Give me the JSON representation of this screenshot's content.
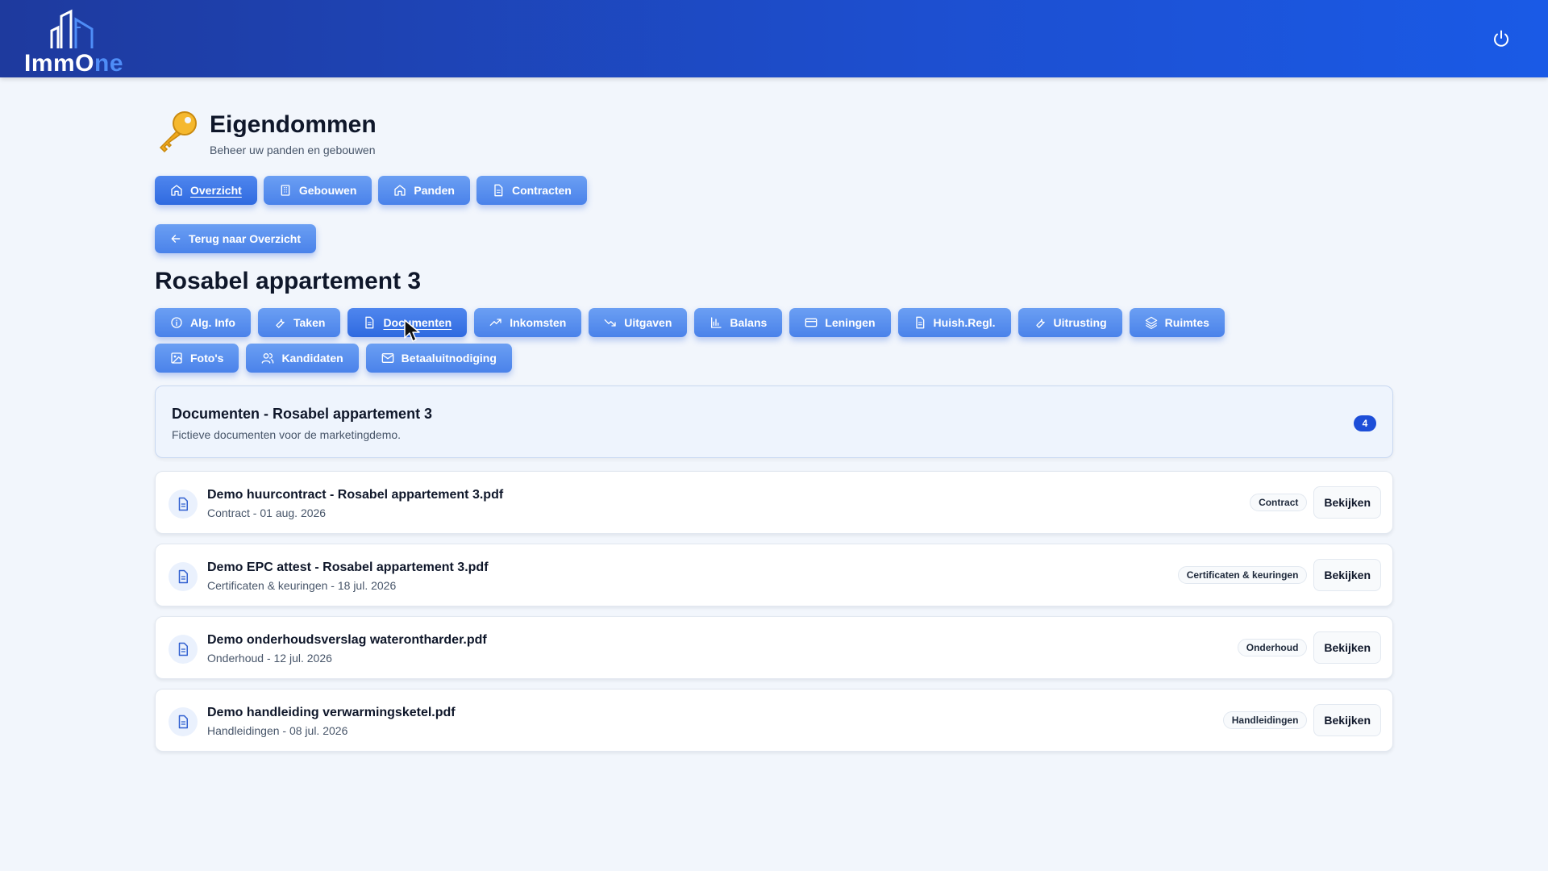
{
  "brand": {
    "logo_main": "ImmO",
    "logo_accent": "ne"
  },
  "header": {
    "power_icon": "power-icon"
  },
  "page": {
    "title": "Eigendommen",
    "subtitle": "Beheer uw panden en gebouwen",
    "icon": "key-icon"
  },
  "main_tabs": [
    {
      "label": "Overzicht",
      "icon": "home-icon",
      "active": true
    },
    {
      "label": "Gebouwen",
      "icon": "building-icon",
      "active": false
    },
    {
      "label": "Panden",
      "icon": "home-icon",
      "active": false
    },
    {
      "label": "Contracten",
      "icon": "document-icon",
      "active": false
    }
  ],
  "back_button": {
    "label": "Terug naar Overzicht",
    "icon": "arrow-left-icon"
  },
  "property": {
    "title": "Rosabel appartement 3"
  },
  "sub_tabs": [
    {
      "label": "Alg. Info",
      "icon": "info-icon",
      "active": false
    },
    {
      "label": "Taken",
      "icon": "wrench-icon",
      "active": false
    },
    {
      "label": "Documenten",
      "icon": "document-icon",
      "active": true
    },
    {
      "label": "Inkomsten",
      "icon": "trending-up-icon",
      "active": false
    },
    {
      "label": "Uitgaven",
      "icon": "trending-down-icon",
      "active": false
    },
    {
      "label": "Balans",
      "icon": "bar-chart-icon",
      "active": false
    },
    {
      "label": "Leningen",
      "icon": "credit-card-icon",
      "active": false
    },
    {
      "label": "Huish.Regl.",
      "icon": "document-icon",
      "active": false
    },
    {
      "label": "Uitrusting",
      "icon": "wrench-icon",
      "active": false
    },
    {
      "label": "Ruimtes",
      "icon": "layers-icon",
      "active": false
    },
    {
      "label": "Foto's",
      "icon": "image-icon",
      "active": false
    },
    {
      "label": "Kandidaten",
      "icon": "users-icon",
      "active": false
    },
    {
      "label": "Betaaluitnodiging",
      "icon": "mail-icon",
      "active": false
    }
  ],
  "documents": {
    "title": "Documenten - Rosabel appartement 3",
    "subtitle": "Fictieve documenten voor de marketingdemo.",
    "count": "4",
    "view_label": "Bekijken",
    "items": [
      {
        "name": "Demo huurcontract - Rosabel appartement 3.pdf",
        "meta": "Contract - 01 aug. 2026",
        "category": "Contract"
      },
      {
        "name": "Demo EPC attest - Rosabel appartement 3.pdf",
        "meta": "Certificaten & keuringen - 18 jul. 2026",
        "category": "Certificaten & keuringen"
      },
      {
        "name": "Demo onderhoudsverslag waterontharder.pdf",
        "meta": "Onderhoud - 12 jul. 2026",
        "category": "Onderhoud"
      },
      {
        "name": "Demo handleiding verwarmingsketel.pdf",
        "meta": "Handleidingen - 08 jul. 2026",
        "category": "Handleidingen"
      }
    ]
  },
  "colors": {
    "header": "#1d4fd0",
    "pill": "#4a82ea",
    "badge": "#1d4ed8",
    "background": "#f2f6fc"
  }
}
